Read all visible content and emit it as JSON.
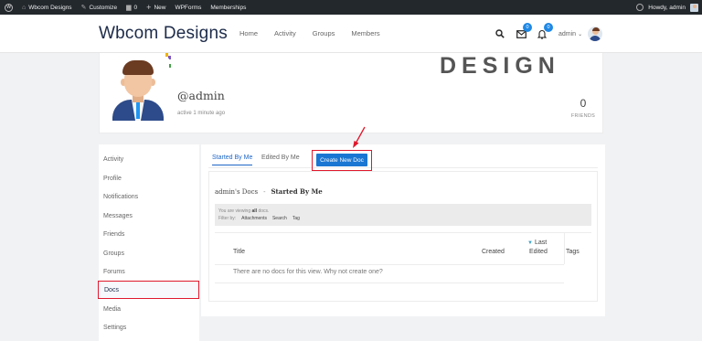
{
  "adminbar": {
    "site": "Wbcom Designs",
    "customize": "Customize",
    "comments_count": "0",
    "new": "New",
    "wpforms": "WPForms",
    "memberships": "Memberships",
    "howdy": "Howdy, admin"
  },
  "header": {
    "brand": "Wbcom Designs",
    "nav": [
      "Home",
      "Activity",
      "Groups",
      "Members"
    ],
    "messages_badge": "0",
    "notifications_badge": "0",
    "user": "admin"
  },
  "profile": {
    "cover_text": "DESIGN",
    "handle": "@admin",
    "active": "active 1 minute ago",
    "friends_count": "0",
    "friends_label": "FRIENDS"
  },
  "sidebar": {
    "items": [
      "Activity",
      "Profile",
      "Notifications",
      "Messages",
      "Friends",
      "Groups",
      "Forums",
      "Docs",
      "Media",
      "Settings"
    ],
    "active": "Docs"
  },
  "docs": {
    "tabs": [
      "Started By Me",
      "Edited By Me"
    ],
    "create_button": "Create New Doc",
    "breadcrumb_root": "admin's Docs",
    "breadcrumb_sep": "-",
    "breadcrumb_current": "Started By Me",
    "viewing_prefix": "You are viewing",
    "viewing_strong": "all",
    "viewing_suffix": "docs.",
    "filter_label": "Filter by:",
    "filters": [
      "Attachments",
      "Search",
      "Tag"
    ],
    "columns": {
      "title": "Title",
      "created": "Created",
      "last": "Last",
      "edited": "Edited",
      "tags": "Tags"
    },
    "empty": "There are no docs for this view. Why not create one?"
  },
  "colors": {
    "accent": "#1976d2",
    "highlight": "#e0182d",
    "adminbar": "#23282d"
  }
}
